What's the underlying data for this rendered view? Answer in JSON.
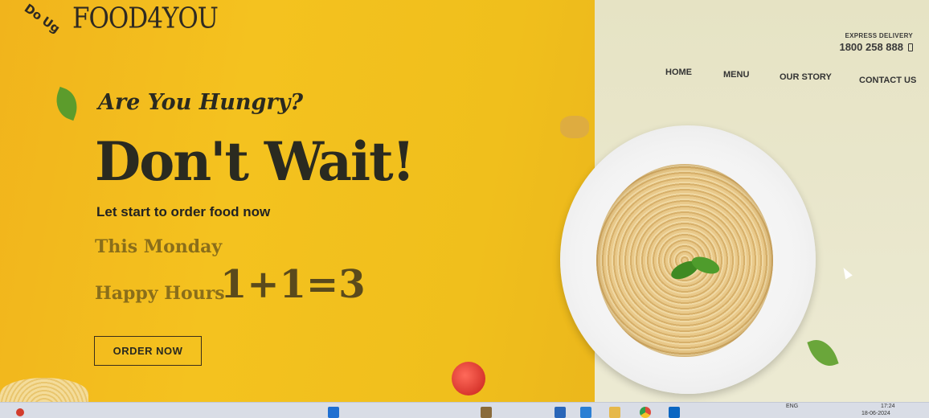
{
  "brand": {
    "name": "FOOD4YOU"
  },
  "contact": {
    "label": "EXPRESS DELIVERY",
    "phone": "1800 258 888"
  },
  "nav": [
    {
      "label": "HOME"
    },
    {
      "label": "MENU"
    },
    {
      "label": "OUR STORY"
    },
    {
      "label": "CONTACT US"
    }
  ],
  "hero": {
    "tagline": "Are You Hungry?",
    "headline": "Don't Wait!",
    "subheadline": "Let start to order food now",
    "promo_day": "This Monday",
    "promo_label": "Happy Hours",
    "promo_formula": "1+1=3",
    "cta": "ORDER NOW"
  },
  "taskbar": {
    "language": "ENG",
    "time": "17:24",
    "date": "18-06-2024"
  },
  "colors": {
    "accent": "#f1b41c",
    "background_right": "#e7e4c6",
    "text_dark": "#2a2a20"
  }
}
